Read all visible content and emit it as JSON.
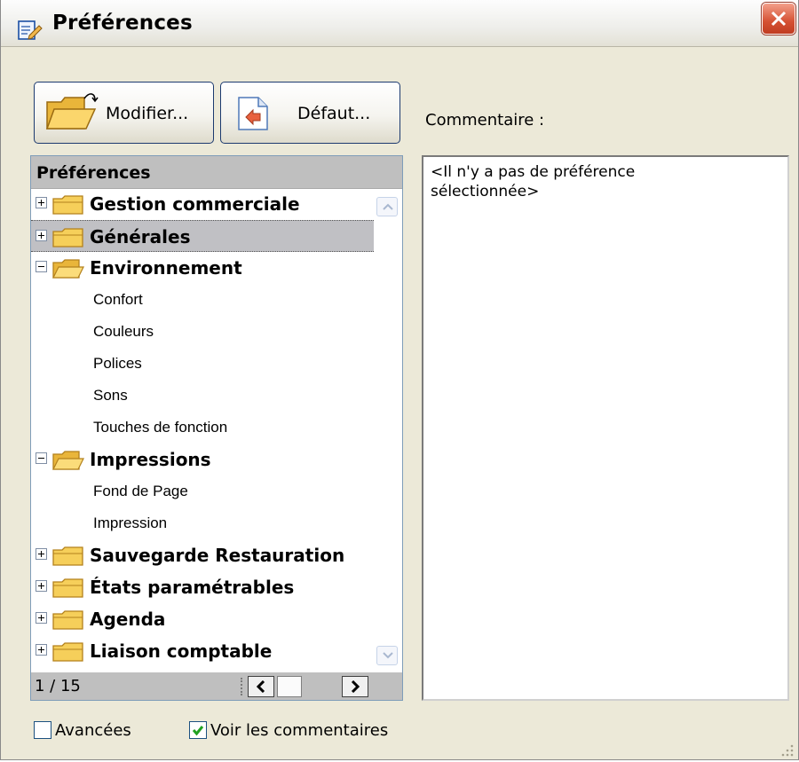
{
  "window": {
    "title": "Préférences",
    "close_icon": "close-icon"
  },
  "toolbar": {
    "modifier_label": "Modifier...",
    "defaut_label": "Défaut..."
  },
  "comment": {
    "label": "Commentaire :",
    "text_line1": "<Il n'y a pas de préférence",
    "text_line2": "sélectionnée>"
  },
  "tree": {
    "header": "Préférences",
    "rows": [
      {
        "label": "Gestion commerciale",
        "type": "category",
        "expander": "plus"
      },
      {
        "label": "Générales",
        "type": "category",
        "expander": "plus",
        "selected": true
      },
      {
        "label": "Environnement",
        "type": "category",
        "expander": "minus"
      },
      {
        "label": "Confort",
        "type": "leaf"
      },
      {
        "label": "Couleurs",
        "type": "leaf"
      },
      {
        "label": "Polices",
        "type": "leaf"
      },
      {
        "label": "Sons",
        "type": "leaf"
      },
      {
        "label": "Touches de fonction",
        "type": "leaf"
      },
      {
        "label": "Impressions",
        "type": "category",
        "expander": "minus"
      },
      {
        "label": "Fond de Page",
        "type": "leaf"
      },
      {
        "label": "Impression",
        "type": "leaf"
      },
      {
        "label": "Sauvegarde Restauration",
        "type": "category",
        "expander": "plus"
      },
      {
        "label": "États paramétrables",
        "type": "category",
        "expander": "plus"
      },
      {
        "label": "Agenda",
        "type": "category",
        "expander": "plus"
      },
      {
        "label": "Liaison comptable",
        "type": "category",
        "expander": "plus"
      }
    ],
    "page_count": "1 / 15"
  },
  "options": {
    "avancees_label": "Avancées",
    "avancees_checked": false,
    "voir_label": "Voir les commentaires",
    "voir_checked": true
  },
  "colors": {
    "selected_row": "#c0c0c4",
    "header_gray": "#bfbfbf",
    "folder_yellow": "#f6cf5a",
    "close_red": "#d55133",
    "check_green": "#21a121"
  }
}
